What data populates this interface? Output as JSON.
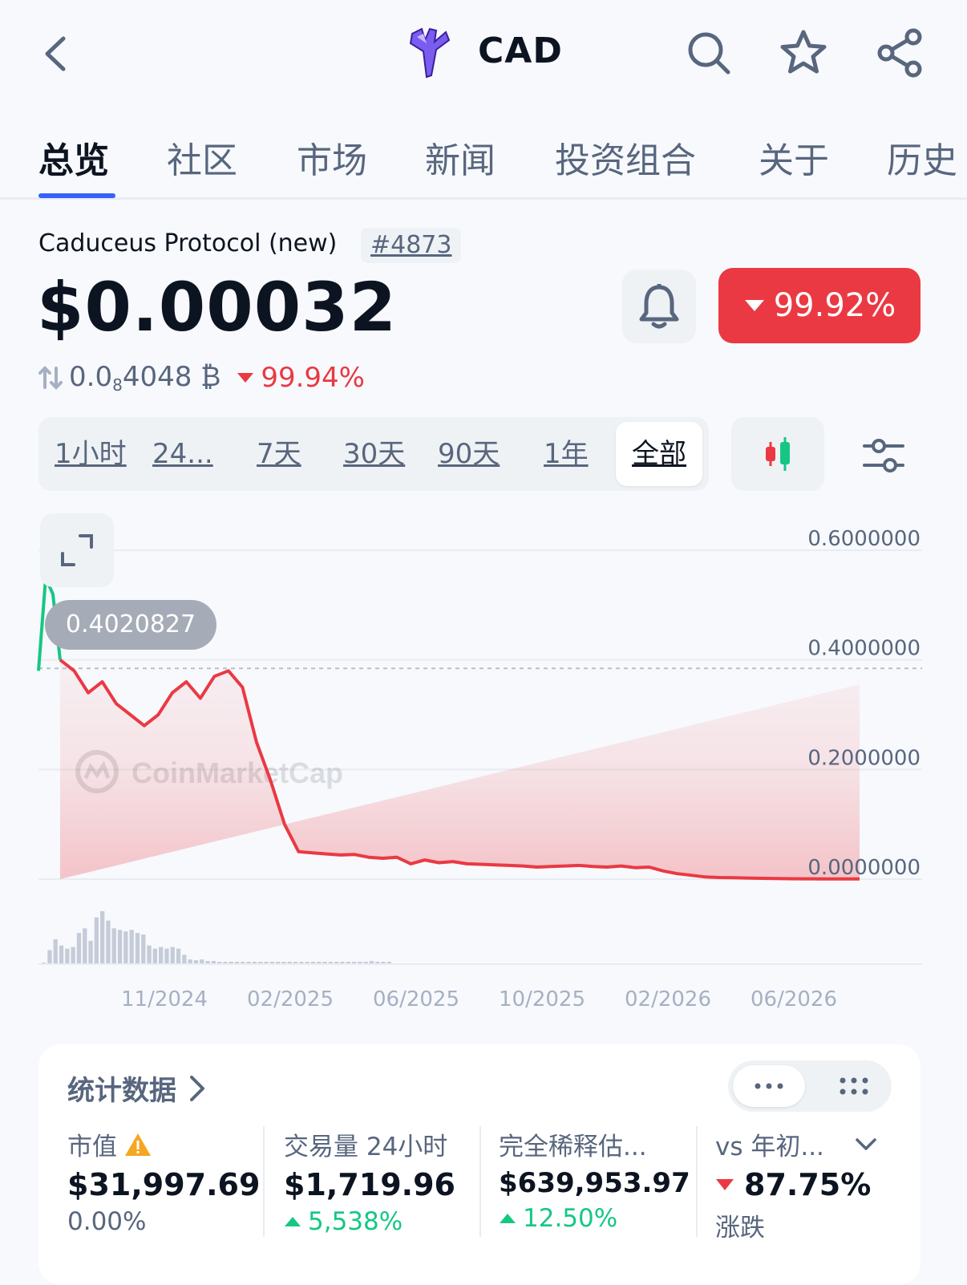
{
  "header": {
    "symbol": "CAD"
  },
  "tabs": [
    "总览",
    "社区",
    "市场",
    "新闻",
    "投资组合",
    "关于",
    "历史"
  ],
  "coin": {
    "name": "Caduceus Protocol (new)",
    "rank": "#4873",
    "price": "$0.00032",
    "change_badge": "99.92%",
    "btc_prefix": "0.0",
    "btc_zero_count": "8",
    "btc_digits": "4048 ₿",
    "btc_change": "99.94%"
  },
  "ranges": [
    "1小时",
    "24...",
    "7天",
    "30天",
    "90天",
    "1年",
    "全部"
  ],
  "selected_range": "全部",
  "chart_data": {
    "type": "line",
    "y_ticks": [
      "0.6000000",
      "0.4000000",
      "0.2000000",
      "0.0000000"
    ],
    "ylim": [
      0,
      0.6
    ],
    "x_ticks": [
      "11/2024",
      "02/2025",
      "06/2025",
      "10/2025",
      "02/2026",
      "06/2026"
    ],
    "reference_price": "0.4020827",
    "watermark": "CoinMarketCap",
    "price_series": [
      0.38,
      0.55,
      0.52,
      0.4,
      0.38,
      0.34,
      0.36,
      0.32,
      0.3,
      0.28,
      0.3,
      0.34,
      0.36,
      0.33,
      0.37,
      0.38,
      0.35,
      0.25,
      0.18,
      0.1,
      0.05,
      0.048,
      0.046,
      0.044,
      0.045,
      0.04,
      0.038,
      0.04,
      0.028,
      0.035,
      0.03,
      0.032,
      0.028,
      0.027,
      0.026,
      0.025,
      0.024,
      0.022,
      0.023,
      0.024,
      0.025,
      0.023,
      0.022,
      0.024,
      0.021,
      0.022,
      0.015,
      0.01,
      0.007,
      0.004,
      0.003,
      0.0025,
      0.002,
      0.0015,
      0.001,
      0.0008,
      0.0006,
      0.0005,
      0.0004,
      0.00035,
      0.00032
    ],
    "volume_bars": [
      2,
      18,
      32,
      24,
      20,
      22,
      40,
      46,
      30,
      60,
      68,
      56,
      46,
      44,
      42,
      44,
      40,
      38,
      24,
      20,
      22,
      20,
      22,
      20,
      12,
      6,
      5,
      6,
      4,
      4,
      3,
      3,
      3,
      3,
      3,
      3,
      3,
      3,
      3,
      3,
      3,
      3,
      3,
      3,
      3,
      3,
      3,
      3,
      3,
      3,
      3,
      3,
      3,
      3,
      3,
      3,
      4,
      3,
      3,
      3
    ]
  },
  "stats": {
    "title": "统计数据",
    "items": [
      {
        "label": "市值",
        "value": "$31,997.69",
        "sub": "0.00%"
      },
      {
        "label": "交易量 24小时",
        "value": "$1,719.96",
        "sub": "5,538%"
      },
      {
        "label": "完全稀释估...",
        "value": "$639,953.97",
        "sub": "12.50%"
      },
      {
        "label": "vs 年初...",
        "value": "87.75%",
        "sub": "涨跌"
      }
    ]
  },
  "colors": {
    "accent": "#3861fb",
    "negative": "#ea3943",
    "positive": "#16c784",
    "muted": "#58667e"
  }
}
